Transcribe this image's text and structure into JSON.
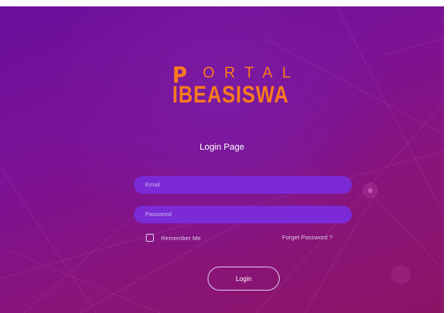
{
  "logo": {
    "top_initial": "P",
    "top_rest": "ORTAL",
    "bottom": "IBEASISWA",
    "color": "#f77a1f"
  },
  "page": {
    "title": "Login Page"
  },
  "form": {
    "email_placeholder": "Email",
    "password_placeholder": "Password",
    "remember_label": "Remember Me",
    "forgot_label": "Forget Password ?",
    "login_label": "Login"
  },
  "colors": {
    "background_top": "#6a0f9c",
    "background_bottom": "#8a1566",
    "input_fill": "#7b2ad6"
  }
}
